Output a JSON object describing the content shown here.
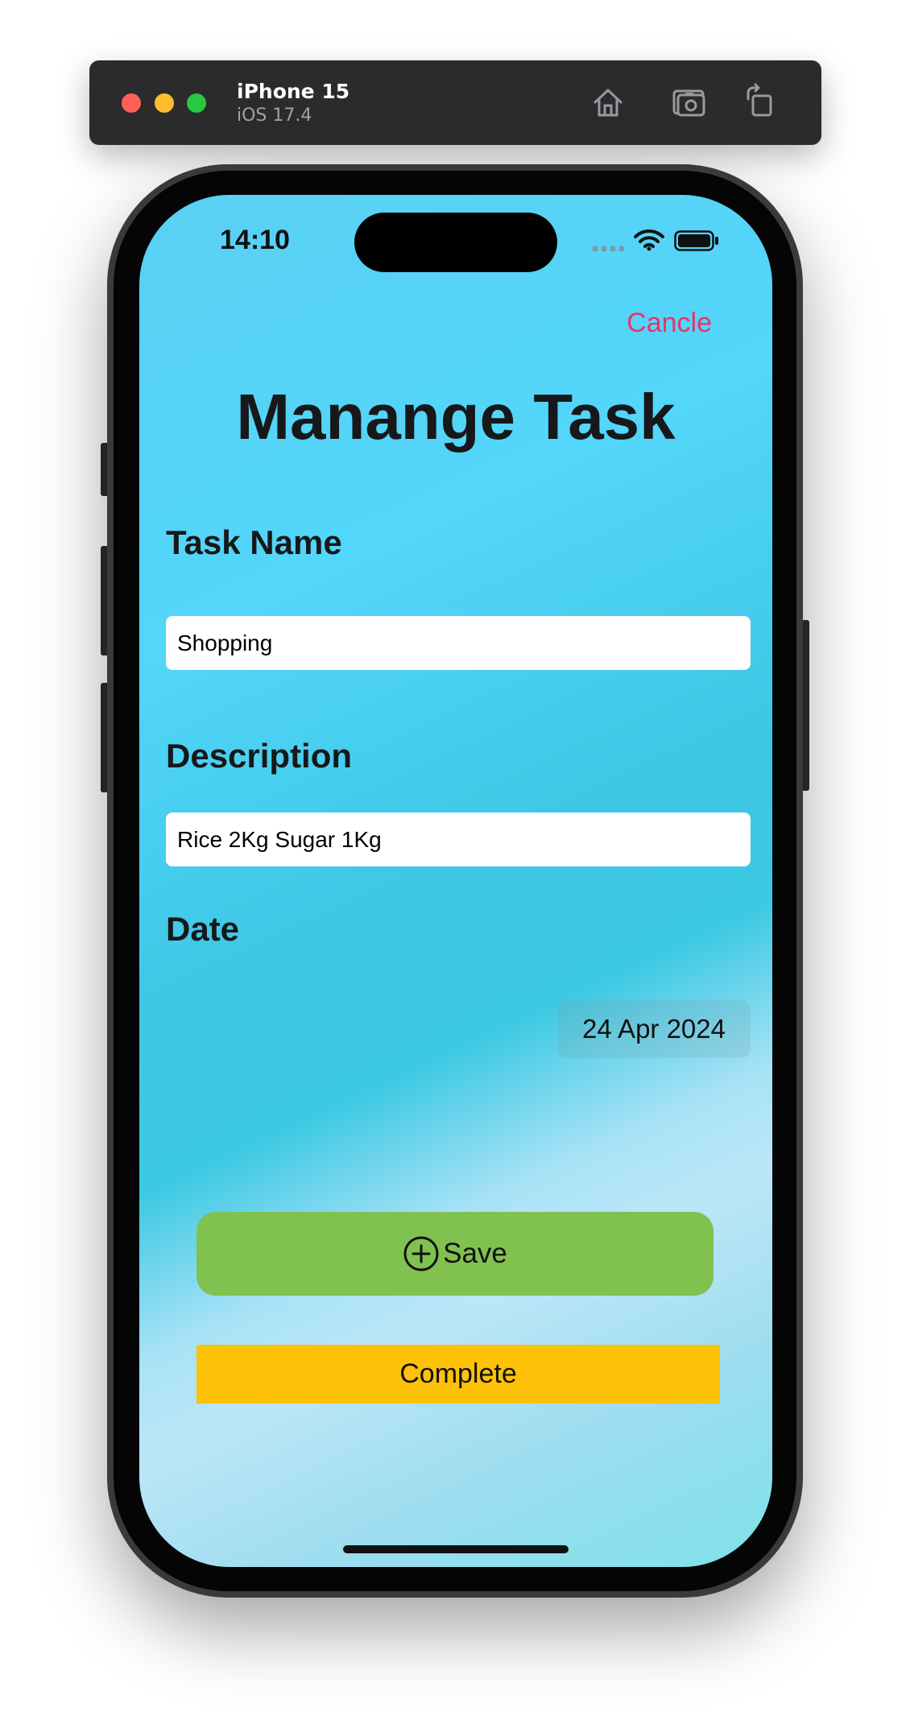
{
  "simulator": {
    "device_name": "iPhone 15",
    "os_version": "iOS 17.4",
    "toolbar_icons": [
      "home-icon",
      "screenshot-icon",
      "rotate-icon"
    ]
  },
  "status_bar": {
    "time": "14:10",
    "icons": [
      "signal-icon",
      "wifi-icon",
      "battery-icon"
    ]
  },
  "nav": {
    "cancel_label": "Cancle"
  },
  "page": {
    "title": "Manange Task"
  },
  "form": {
    "task_name_label": "Task Name",
    "task_name_value": "Shopping",
    "description_label": "Description",
    "description_value": "Rice 2Kg Sugar 1Kg",
    "date_label": "Date",
    "date_value": "24 Apr 2024"
  },
  "actions": {
    "save_label": "Save",
    "save_icon": "plus-circle-icon",
    "complete_label": "Complete"
  },
  "colors": {
    "accent_cancel": "#e8336b",
    "save_button": "#80c150",
    "complete_button": "#fdc107",
    "background": "#52d6fa"
  }
}
